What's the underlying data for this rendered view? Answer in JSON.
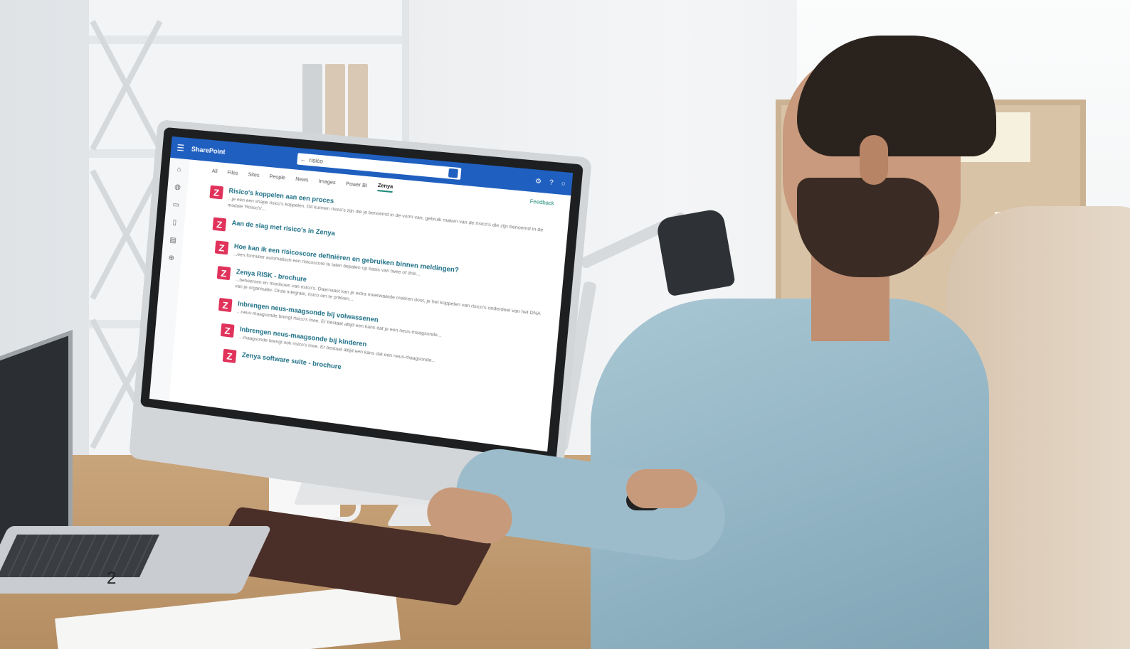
{
  "caption_number": "2",
  "monitor": {
    "app": {
      "brand": "SharePoint",
      "search_query": "risico",
      "icons": [
        "waffle-icon",
        "gear-icon",
        "help-icon",
        "account-icon"
      ]
    },
    "tabs": [
      {
        "label": "All",
        "active": false
      },
      {
        "label": "Files",
        "active": false
      },
      {
        "label": "Sites",
        "active": false
      },
      {
        "label": "People",
        "active": false
      },
      {
        "label": "News",
        "active": false
      },
      {
        "label": "Images",
        "active": false
      },
      {
        "label": "Power BI",
        "active": false
      },
      {
        "label": "Zenya",
        "active": true
      }
    ],
    "feedback_label": "Feedback",
    "results": [
      {
        "title": "Risico's koppelen aan een proces",
        "snippet": "...je een een shape risico's koppelen. Dit kunnen risico's zijn die je benoemd in de vorm van, gebruik maken van de risico's die zijn benoemd in de module 'Risico's'..."
      },
      {
        "title": "Aan de slag met risico's in Zenya",
        "snippet": ""
      },
      {
        "title": "Hoe kan ik een risicoscore definiëren en gebruiken binnen meldingen?",
        "snippet": "...een formulier automatisch een risicoscore te laten bepalen op basis van twee of drie..."
      },
      {
        "title": "Zenya RISK - brochure",
        "snippet": "...beheersen en monitoren van risico's. Daarnaast kan je extra meerwaarde creëren door, je het koppelen van risico's onderdeel van het DNA van je organisatie. Onze integrale, risico om te prikken..."
      },
      {
        "title": "Inbrengen neus-maagsonde bij volwassenen",
        "snippet": "...neus-maagsonde brengt risico's mee. Er bestaat altijd een kans dat je een neus-maagsonde..."
      },
      {
        "title": "Inbrengen neus-maagsonde bij kinderen",
        "snippet": "...maagsonde brengt ook risico's mee. Er bestaat altijd een kans dat een neus-maagsonde..."
      },
      {
        "title": "Zenya software suite - brochure",
        "snippet": ""
      }
    ],
    "logo_letter": "Z",
    "colors": {
      "topbar": "#1f5fbf",
      "logo": "#e0325a",
      "result_title": "#1c6f85",
      "accent": "#1f8a7a"
    }
  }
}
